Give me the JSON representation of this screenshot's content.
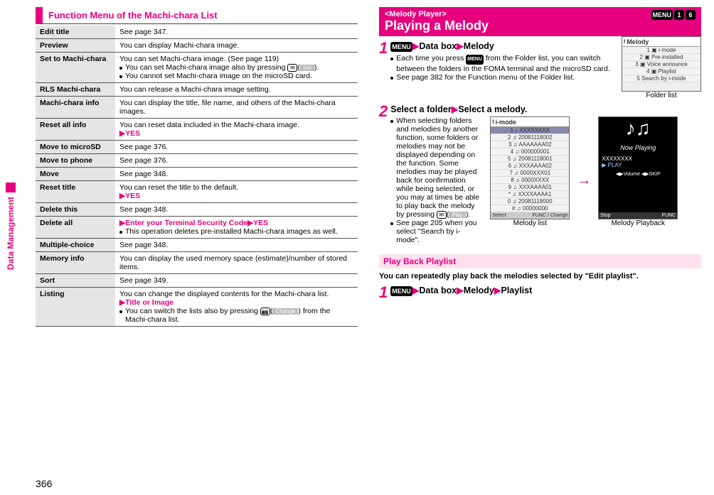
{
  "pageNumber": "366",
  "sideLabel": "Data Management",
  "left": {
    "sectionTitle": "Function Menu of the Machi-chara List",
    "rows": [
      {
        "k": "Edit title",
        "v": "See page 347."
      },
      {
        "k": "Preview",
        "v": "You can display Machi-chara image."
      },
      {
        "k": "Set to Machi-chara",
        "v": "You can set Machi-chara image. (See page 119)",
        "b1": "You can set Machi-chara image also by pressing ",
        "btn": "✉",
        "lbl": "Set",
        "b2": ".",
        "b3": "You cannot set Machi-chara image on the microSD card."
      },
      {
        "k": "RLS Machi-chara",
        "v": "You can release a Machi-chara image setting."
      },
      {
        "k": "Machi-chara info",
        "v": "You can display the title, file name, and others of the Machi-chara images."
      },
      {
        "k": "Reset all info",
        "v": "You can reset data included in the Machi-chara image.",
        "sub": "▶YES"
      },
      {
        "k": "Move to microSD",
        "v": "See page 376."
      },
      {
        "k": "Move to phone",
        "v": "See page 376."
      },
      {
        "k": "Move",
        "v": "See page 348."
      },
      {
        "k": "Reset title",
        "v": "You can reset the title to the default.",
        "sub": "▶YES"
      },
      {
        "k": "Delete this",
        "v": "See page 348."
      },
      {
        "k": "Delete all",
        "sub": "▶Enter your Terminal Security Code▶YES",
        "b1": "This operation deletes pre-installed Machi-chara images as well."
      },
      {
        "k": "Multiple-choice",
        "v": "See page 348."
      },
      {
        "k": "Memory info",
        "v": "You can display the used memory space (estimate)/number of stored items."
      },
      {
        "k": "Sort",
        "v": "See page 349."
      },
      {
        "k": "Listing",
        "v": "You can change the displayed contents for the Machi-chara list.",
        "sub": "▶Title or Image",
        "b1": "You can switch the lists also by pressing ",
        "btn": "📷",
        "lbl": "Change",
        "b2": " from the Machi-chara list."
      }
    ]
  },
  "right": {
    "tag": "<Melody Player>",
    "title": "Playing a Melody",
    "keys": [
      "MENU",
      "1",
      "6"
    ],
    "step1": {
      "num": "1",
      "menuKey": "MENU",
      "t1": "Data box",
      "t2": "Melody",
      "b1": "Each time you press ",
      "btn": "MENU",
      "b2": " from the Folder list, you can switch between the folders in the FOMA terminal and the microSD card.",
      "b3": "See page 382 for the Function menu of the Folder list.",
      "figCaption": "Folder list",
      "fig": {
        "title": "Melody",
        "items": [
          "1 ▣ i-mode",
          "2 ▣ Pre-installed",
          "3 ▣ Voice announce",
          "4 ▣ Playlist",
          "5   Search by i-mode"
        ]
      }
    },
    "step2": {
      "num": "2",
      "t1": "Select a folder",
      "t2": "Select a melody.",
      "b1": "When selecting folders and melodies by another function, some folders or melodies may not be displayed depending on the function. Some melodies may be played back for confirmation while being selected, or you may at times be able to play back the melody by pressing ",
      "btn": "✉",
      "lbl": "Play",
      "b2": ".",
      "b3": "See page 205 when you select \"Search by i-mode\".",
      "figA": {
        "title": "i-mode",
        "caption": "Melody list",
        "items": [
          "1 ♪ XXXXXXXX",
          "2 ♫ 20081118002",
          "3 ♫ AAAAAAA02",
          "4 ♫ 000000001",
          "5 ♫ 20081118001",
          "6 ♫ XXXAAAA02",
          "7 ♫ 0000XXX01",
          "8 ♫ 0000XXXX",
          "9 ♫ XXXAAAA01",
          "* ♫ XXXXAAAA1",
          "0 ♫ 20081118000",
          "# ♫ 00000000"
        ],
        "footL": "Select",
        "footR": "FUNC / Change"
      },
      "figB": {
        "caption": "Melody Playback",
        "nowPlaying": "Now Playing",
        "track": "XXXXXXXX",
        "play": "▶ PLAY",
        "vol": "◀▶Volume  ◀▶SKIP",
        "footL": "Stop",
        "footR": "FUNC"
      }
    },
    "playback": {
      "title": "Play Back Playlist",
      "desc": "You can repeatedly play back the melodies selected by \"Edit playlist\".",
      "step": {
        "num": "1",
        "menuKey": "MENU",
        "t1": "Data box",
        "t2": "Melody",
        "t3": "Playlist"
      }
    }
  }
}
